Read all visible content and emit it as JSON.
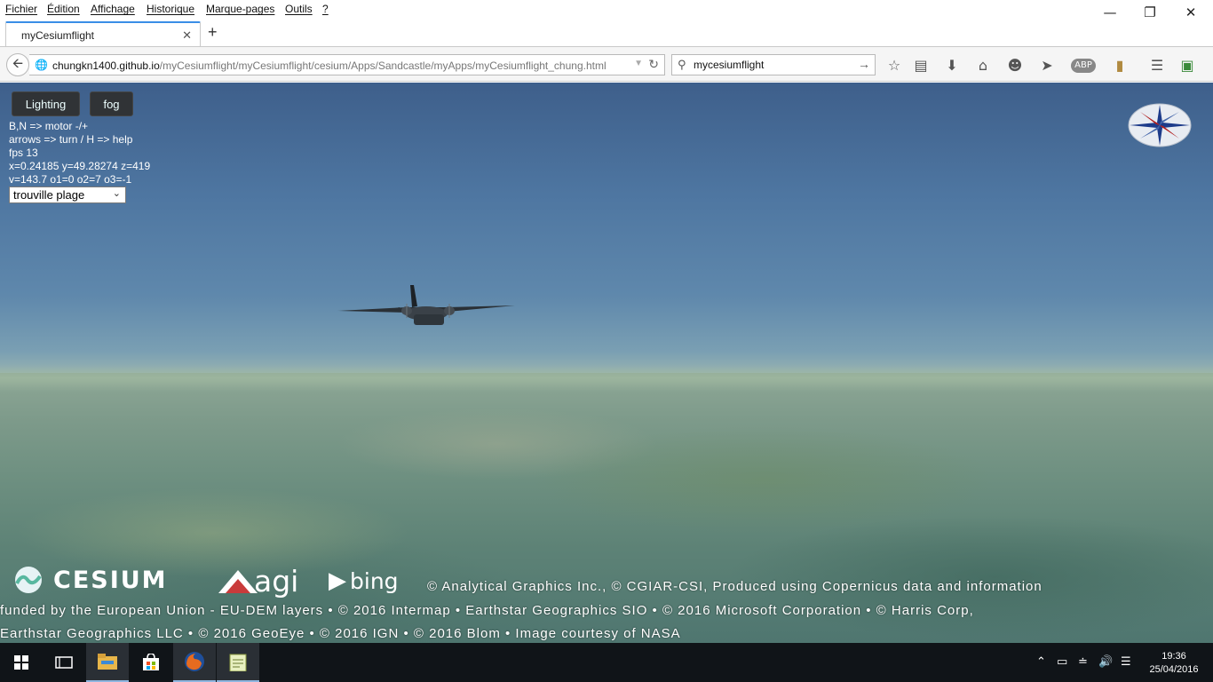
{
  "menubar": {
    "items": [
      "Fichier",
      "Édition",
      "Affichage",
      "Historique",
      "Marque-pages",
      "Outils",
      "?"
    ],
    "minimize_icon": "minimize-icon",
    "restore_icon": "restore-icon",
    "close_icon": "close-icon"
  },
  "tab": {
    "title": "myCesiumflight",
    "close_icon": "close-icon",
    "new_tab_icon": "plus-icon"
  },
  "navbar": {
    "url_host": "chungkn1400.github.io",
    "url_path": "/myCesiumflight/myCesiumflight/cesium/Apps/Sandcastle/myApps/myCesiumflight_chung.html",
    "search_value": "mycesiumflight",
    "toolbar_icons": [
      "star-icon",
      "reading-list-icon",
      "download-icon",
      "home-icon",
      "chat-icon",
      "send-icon",
      "adblock-icon",
      "bookmark-icon",
      "menu-icon",
      "extension-icon"
    ]
  },
  "viewer": {
    "lighting_label": "Lighting",
    "fog_label": "fog",
    "hud": {
      "line1": "B,N => motor -/+",
      "line2": "arrows => turn / H => help",
      "line3": "fps 13",
      "line4": "x=0.24185 y=49.28274 z=419",
      "line5": "v=143.7 o1=0 o2=7 o3=-1"
    },
    "location_selected": "trouville plage"
  },
  "credits": {
    "cesium": "CESIUM",
    "agi": "agi",
    "bing": "bing",
    "line1": "© Analytical Graphics Inc., © CGIAR-CSI, Produced using Copernicus data and information",
    "line2": "funded by the European Union - EU-DEM layers • © 2016 Intermap • Earthstar Geographics SIO • © 2016 Microsoft Corporation • © Harris Corp,",
    "line3": "Earthstar Geographics LLC • © 2016 GeoEye • © 2016 IGN • © 2016 Blom • Image courtesy of NASA"
  },
  "taskbar": {
    "time": "19:36",
    "date": "25/04/2016",
    "apps": [
      "windows-start-icon",
      "task-view-icon",
      "file-explorer-icon",
      "store-icon",
      "firefox-icon",
      "notepad-icon"
    ]
  },
  "colors": {
    "tab_accent": "#3a8ee6",
    "cesium_button": "#303336",
    "taskbar": "#101418"
  }
}
